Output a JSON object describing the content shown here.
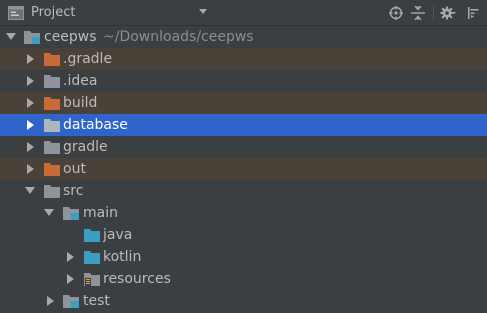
{
  "header": {
    "title": "Project",
    "icons": {
      "project": "project-view-icon",
      "dropdown": "chevron-down-icon",
      "scroll_from_source": "crosshair-icon",
      "collapse_all": "collapse-all-icon",
      "settings": "gear-icon",
      "hide": "hide-panel-icon"
    }
  },
  "colors": {
    "panel_bg": "#3c3f41",
    "excluded_row_bg": "#4a4138",
    "selection_bg": "#2f65ca",
    "folder_gray": "#8d949c",
    "folder_excluded": "#c76b3a",
    "folder_source": "#3a9fc2",
    "text": "#bbbbbb",
    "path_text": "#8c8c8c"
  },
  "tree": {
    "root": {
      "label": "ceepws",
      "path": "~/Downloads/ceepws",
      "icon": "module-folder-icon",
      "expanded": true
    },
    "items": [
      {
        "label": ".gradle",
        "icon": "excluded-folder-icon",
        "expanded": false,
        "excluded": true
      },
      {
        "label": ".idea",
        "icon": "folder-icon",
        "expanded": false,
        "excluded": false
      },
      {
        "label": "build",
        "icon": "excluded-folder-icon",
        "expanded": false,
        "excluded": true
      },
      {
        "label": "database",
        "icon": "folder-icon",
        "expanded": false,
        "selected": true
      },
      {
        "label": "gradle",
        "icon": "folder-icon",
        "expanded": false,
        "excluded": false
      },
      {
        "label": "out",
        "icon": "excluded-folder-icon",
        "expanded": false,
        "excluded": true
      },
      {
        "label": "src",
        "icon": "folder-icon",
        "expanded": true,
        "excluded": false
      },
      {
        "label": "main",
        "icon": "module-folder-icon",
        "expanded": true
      },
      {
        "label": "java",
        "icon": "source-folder-icon",
        "expanded": false
      },
      {
        "label": "kotlin",
        "icon": "source-folder-icon",
        "expanded": false
      },
      {
        "label": "resources",
        "icon": "resources-folder-icon",
        "expanded": false
      },
      {
        "label": "test",
        "icon": "module-folder-icon",
        "expanded": false
      }
    ]
  }
}
